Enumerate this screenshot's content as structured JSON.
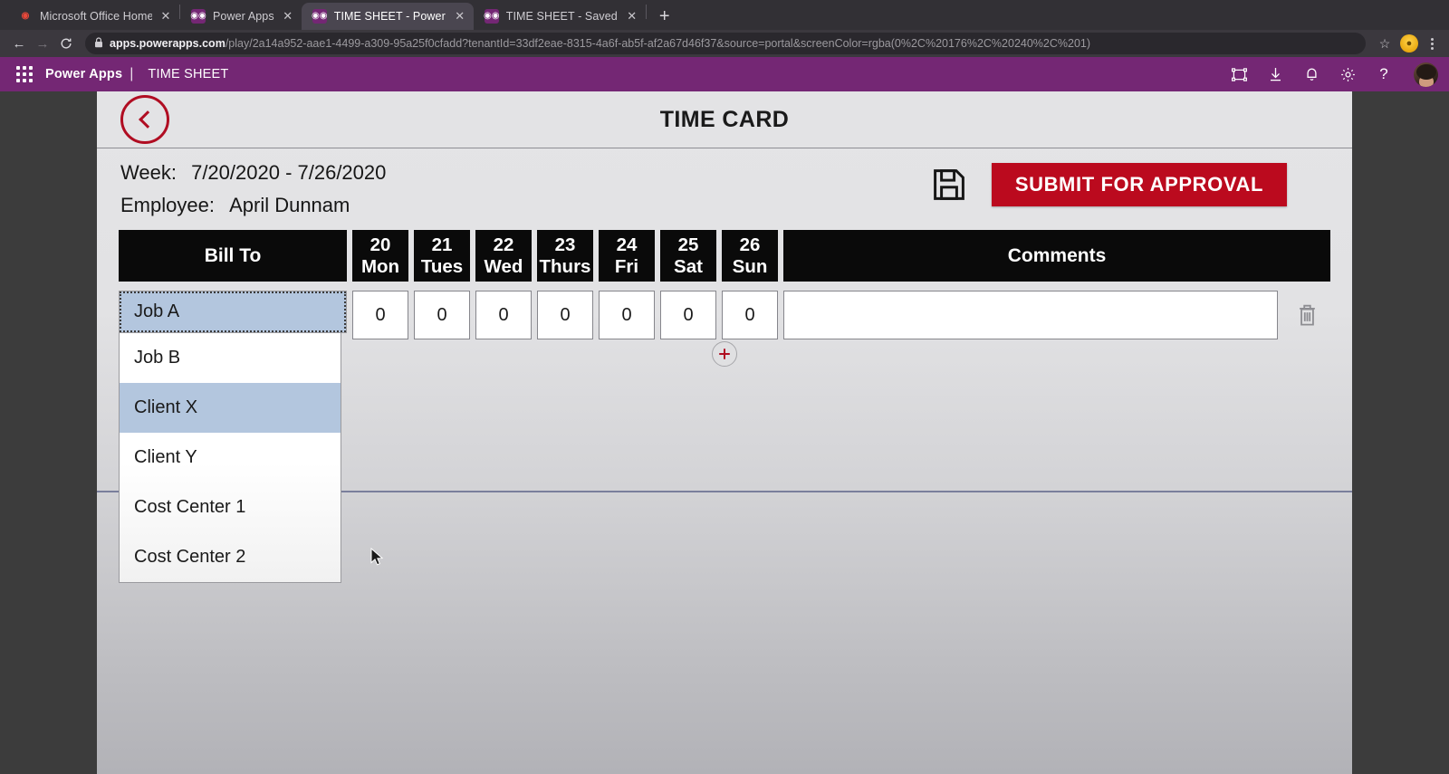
{
  "browser": {
    "tabs": [
      {
        "title": "Microsoft Office Home",
        "favicon": "office-icon",
        "active": false
      },
      {
        "title": "Power Apps",
        "favicon": "powerapps-icon",
        "active": false
      },
      {
        "title": "TIME SHEET - Power Apps",
        "favicon": "powerapps-icon",
        "active": true
      },
      {
        "title": "TIME SHEET - Saved (Unpublis",
        "favicon": "powerapps-icon",
        "active": false
      }
    ],
    "new_tab_label": "+",
    "close_label": "✕",
    "nav": {
      "back": "←",
      "forward": "→",
      "reload": "⟳"
    },
    "omnibox": {
      "lock": "🔒",
      "domain": "apps.powerapps.com",
      "path": "/play/2a14a952-aae1-4499-a309-95a25f0cfadd?tenantId=33df2eae-8315-4a6f-ab5f-af2a67d46f37&source=portal&screenColor=rgba(0%2C%20176%2C%20240%2C%201)"
    },
    "star_label": "☆",
    "profile_label": "●",
    "menu_label": "kebab-menu-icon"
  },
  "powerapps_header": {
    "waffle": "app-launcher-icon",
    "brand": "Power Apps",
    "separator": "|",
    "app_name": "TIME SHEET",
    "icons": [
      {
        "name": "fullscreen-icon",
        "glyph": "⛶"
      },
      {
        "name": "download-icon",
        "glyph": "↓"
      },
      {
        "name": "notifications-icon",
        "glyph": "🔔"
      },
      {
        "name": "settings-icon",
        "glyph": "⚙"
      },
      {
        "name": "help-icon",
        "glyph": "?"
      }
    ],
    "avatar": "user-avatar"
  },
  "app": {
    "back_button": "back-arrow",
    "title": "TIME CARD",
    "week_label": "Week:",
    "week_value": "7/20/2020 - 7/26/2020",
    "employee_label": "Employee:",
    "employee_value": "April Dunnam",
    "save_icon": "save-floppy-icon",
    "submit_label": "SUBMIT FOR APPROVAL",
    "add_row_label": "+",
    "delete_row_icon": "trash-icon",
    "colors": {
      "brand_purple": "#742774",
      "submit_red": "#bb0a1e",
      "accent_red": "#b00d22",
      "header_black": "#0a0a0a",
      "dropdown_highlight": "#b3c6de"
    },
    "table": {
      "headers": [
        {
          "label": "Bill To",
          "sub": ""
        },
        {
          "label": "20",
          "sub": "Mon"
        },
        {
          "label": "21",
          "sub": "Tues"
        },
        {
          "label": "22",
          "sub": "Wed"
        },
        {
          "label": "23",
          "sub": "Thurs"
        },
        {
          "label": "24",
          "sub": "Fri"
        },
        {
          "label": "25",
          "sub": "Sat"
        },
        {
          "label": "26",
          "sub": "Sun"
        },
        {
          "label": "Comments",
          "sub": ""
        }
      ],
      "row": {
        "bill_to_selected": "Job A",
        "hours": [
          "0",
          "0",
          "0",
          "0",
          "0",
          "0",
          "0"
        ],
        "comments_value": "",
        "comments_placeholder": ""
      },
      "dropdown_options": [
        {
          "label": "Job A",
          "state": "selected"
        },
        {
          "label": "Job B",
          "state": "normal"
        },
        {
          "label": "Client X",
          "state": "hover"
        },
        {
          "label": "Client Y",
          "state": "normal"
        },
        {
          "label": "Cost Center 1",
          "state": "normal"
        },
        {
          "label": "Cost Center 2",
          "state": "normal"
        }
      ]
    }
  }
}
